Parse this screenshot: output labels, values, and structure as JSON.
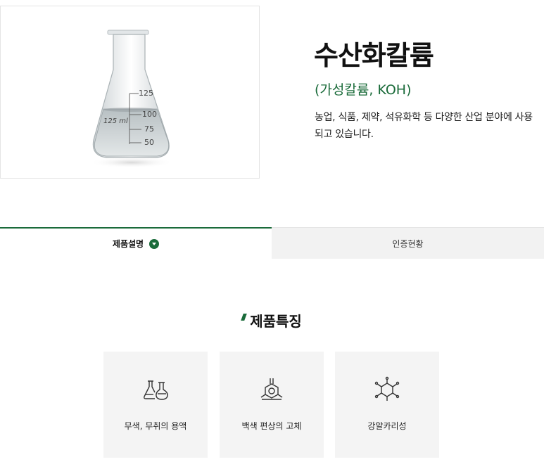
{
  "product": {
    "title": "수산화칼륨",
    "subtitle": "(가성칼륨, KOH)",
    "description": "농업, 식품, 제약, 석유화학 등 다양한 산업 분야에 사용되고 있습니다."
  },
  "image": {
    "alt": "flask-photo",
    "flask_labels": [
      "125",
      "125 ml",
      "100",
      "75",
      "50"
    ]
  },
  "tabs": [
    {
      "label": "제품설명",
      "active": true
    },
    {
      "label": "인증현황",
      "active": false
    }
  ],
  "features": {
    "title": "제품특징",
    "items": [
      {
        "label": "무색, 무취의 용액",
        "icon": "flasks-icon"
      },
      {
        "label": "백색 편상의 고체",
        "icon": "molecule-flask-icon"
      },
      {
        "label": "강알카리성",
        "icon": "hexagon-molecule-icon"
      }
    ]
  },
  "colors": {
    "accent": "#1a6b3a",
    "card_bg": "#f4f4f4",
    "tab_inactive_bg": "#f2f2f2"
  }
}
